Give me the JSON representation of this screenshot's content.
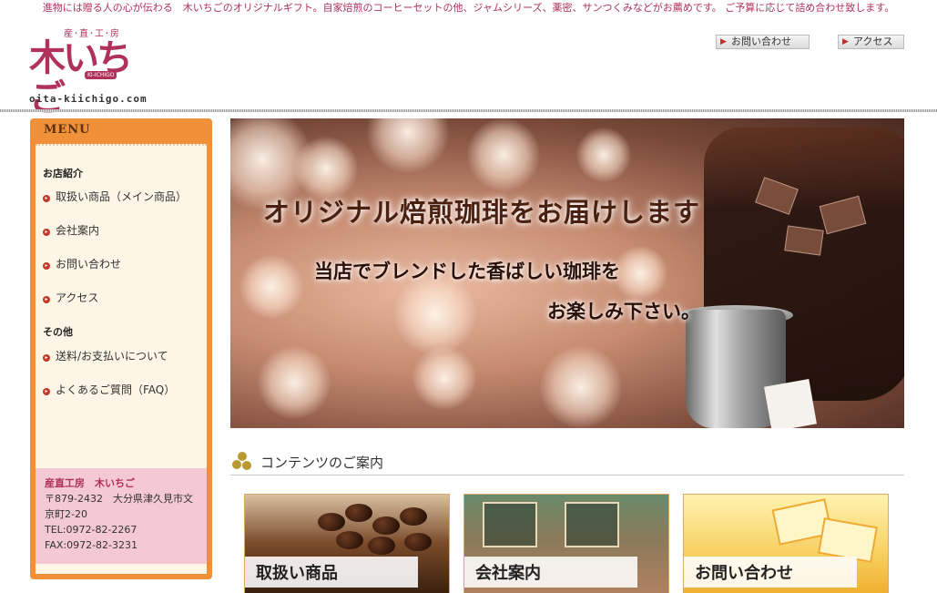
{
  "topbar": {
    "text": "進物には贈る人の心が伝わる　木いちごのオリジナルギフト。自家焙煎のコーヒーセットの他、ジャムシリーズ、薬密、サンつくみなどがお薦めです。 ご予算に応じて詰め合わせ致します。"
  },
  "logo": {
    "sub": "産･直･工･房",
    "main": "木いちご",
    "tag": "KI-ICHIGO",
    "url": "oita-kiichigo.com"
  },
  "header": {
    "contact_label": "お問い合わせ",
    "access_label": "アクセス"
  },
  "sidebar": {
    "title": "MENU",
    "categories": [
      {
        "label": "お店紹介",
        "items": [
          "取扱い商品（メイン商品）",
          "会社案内",
          "お問い合わせ",
          "アクセス"
        ]
      },
      {
        "label": "その他",
        "items": [
          "送料/お支払いについて",
          "よくあるご質問（FAQ）"
        ]
      }
    ],
    "address": {
      "name": "産直工房　木いちご",
      "zip_addr1": "〒879-2432　大分県津久見市文",
      "addr2": "京町2-20",
      "tel": "TEL:0972-82-2267",
      "fax": "FAX:0972-82-3231"
    }
  },
  "banner": {
    "headline": "オリジナル焙煎珈琲をお届けします",
    "line2": "当店でブレンドした香ばしい珈琲を",
    "line3": "お楽しみ下さい。"
  },
  "contents": {
    "title": "コンテンツのご案内",
    "cards": [
      "取扱い商品",
      "会社案内",
      "お問い合わせ"
    ]
  },
  "colors": {
    "brand": "#b0325a",
    "menu_orange": "#f0913a",
    "menu_bg": "#fdf6e7",
    "address_bg": "#f4c9d3"
  }
}
